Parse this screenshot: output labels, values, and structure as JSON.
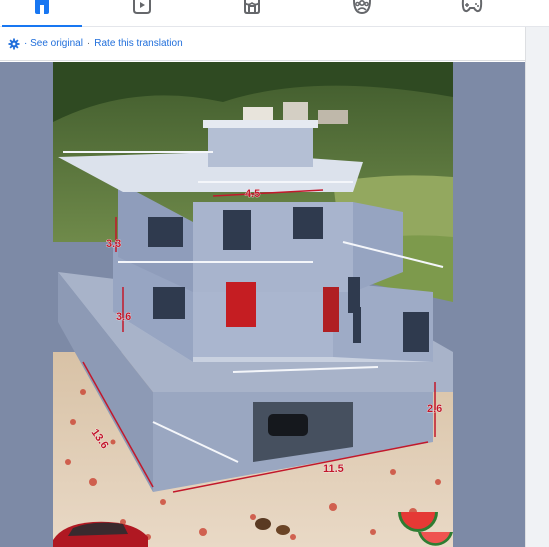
{
  "nav": {
    "items": [
      {
        "name": "home",
        "icon": "home-icon",
        "active": true
      },
      {
        "name": "video",
        "icon": "video-icon",
        "active": false
      },
      {
        "name": "marketplace",
        "icon": "marketplace-icon",
        "active": false
      },
      {
        "name": "groups",
        "icon": "groups-icon",
        "active": false
      },
      {
        "name": "gaming",
        "icon": "gaming-icon",
        "active": false
      }
    ],
    "accent": "#1877f2"
  },
  "translation": {
    "see_original": "· See original",
    "separator": "·",
    "rate": "Rate this translation"
  },
  "photo": {
    "dimensions": {
      "roof_width": "4.5",
      "floor3_height": "3.3",
      "floor2_height": "3.6",
      "depth": "13.6",
      "front_width": "11.5",
      "ground_height": "2.6"
    }
  }
}
